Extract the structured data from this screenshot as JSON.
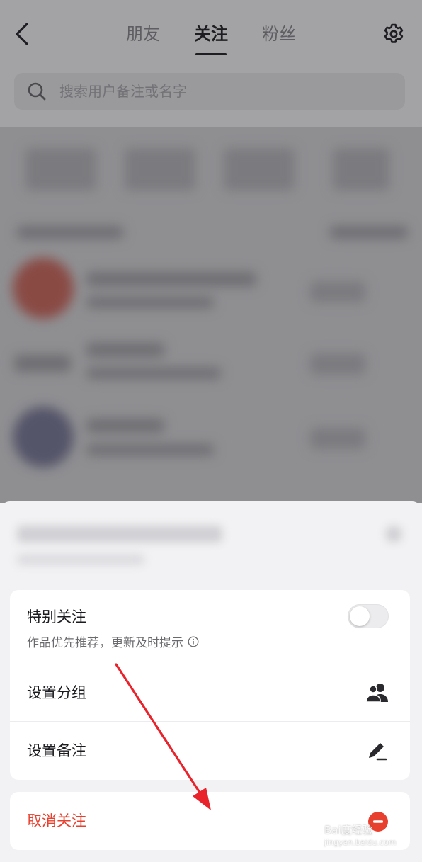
{
  "header": {
    "tabs": [
      {
        "label": "朋友",
        "active": false
      },
      {
        "label": "关注",
        "active": true
      },
      {
        "label": "粉丝",
        "active": false
      }
    ]
  },
  "search": {
    "placeholder": "搜索用户备注或名字"
  },
  "sheet": {
    "special_follow": {
      "title": "特别关注",
      "subtitle": "作品优先推荐，更新及时提示",
      "enabled": false
    },
    "set_group": {
      "label": "设置分组"
    },
    "set_remark": {
      "label": "设置备注"
    },
    "unfollow": {
      "label": "取消关注"
    }
  },
  "icons": {
    "back": "chevron-left-icon",
    "settings": "gear-icon",
    "search": "search-icon",
    "info": "info-icon",
    "group": "users-icon",
    "remark": "pencil-icon",
    "unfollow": "minus-circle-icon"
  },
  "colors": {
    "accent_red": "#e8402e",
    "annotation_arrow": "#e8232b"
  },
  "watermark": {
    "brand": "Bai度经验",
    "url": "jingyan.baidu.com"
  }
}
